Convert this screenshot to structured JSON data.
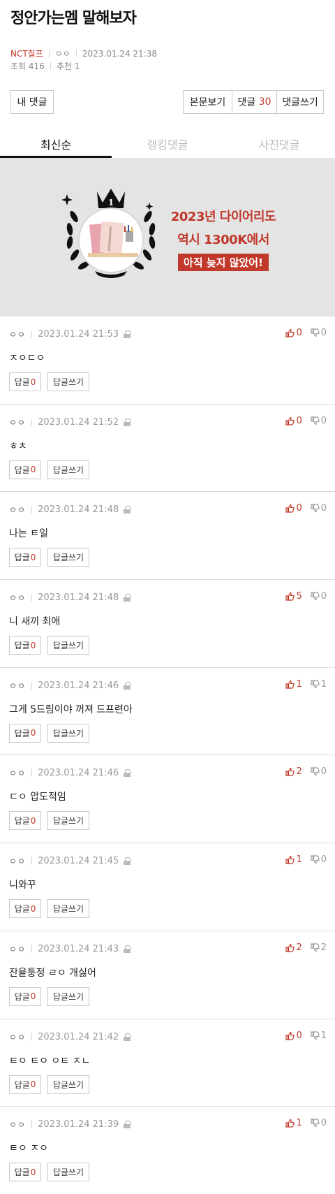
{
  "post": {
    "title": "정안가는멤 말해보자",
    "category": "NCT칠프",
    "author": "ㅇㅇ",
    "date": "2023.01.24 21:38",
    "views_label": "조회 416",
    "recommend_label": "추천 1"
  },
  "toolbar": {
    "my_comments": "내 댓글",
    "view_body": "본문보기",
    "comments_label": "댓글",
    "comments_count": "30",
    "write_comment": "댓글쓰기"
  },
  "tabs": [
    {
      "label": "최신순",
      "active": true
    },
    {
      "label": "랭킹댓글",
      "active": false
    },
    {
      "label": "사진댓글",
      "active": false
    }
  ],
  "banner": {
    "line1": "2023년 다이어리도",
    "line2": "역시 1300K에서",
    "line3": "아직 늦지 않았어!",
    "rank": "1",
    "accent": "#c0392b"
  },
  "reply_label": "답글",
  "reply_write_label": "답글쓰기",
  "comments": [
    {
      "author": "ㅇㅇ",
      "date": "2023.01.24 21:53",
      "text": "ㅈㅇㄷㅇ",
      "up": "0",
      "down": "0",
      "replies": "0"
    },
    {
      "author": "ㅇㅇ",
      "date": "2023.01.24 21:52",
      "text": "ㅎㅊ",
      "up": "0",
      "down": "0",
      "replies": "0"
    },
    {
      "author": "ㅇㅇ",
      "date": "2023.01.24 21:48",
      "text": "나는 ㅌ일",
      "up": "0",
      "down": "0",
      "replies": "0"
    },
    {
      "author": "ㅇㅇ",
      "date": "2023.01.24 21:48",
      "text": "니 새끼 최애",
      "up": "5",
      "down": "0",
      "replies": "0"
    },
    {
      "author": "ㅇㅇ",
      "date": "2023.01.24 21:46",
      "text": "그게 5드림이야 꺼져 드프련아",
      "up": "1",
      "down": "1",
      "replies": "0"
    },
    {
      "author": "ㅇㅇ",
      "date": "2023.01.24 21:46",
      "text": "ㄷㅇ 압도적임",
      "up": "2",
      "down": "0",
      "replies": "0"
    },
    {
      "author": "ㅇㅇ",
      "date": "2023.01.24 21:45",
      "text": "니와꾸",
      "up": "1",
      "down": "0",
      "replies": "0"
    },
    {
      "author": "ㅇㅇ",
      "date": "2023.01.24 21:43",
      "text": "잔윹퉁정 ㄹㅇ 개싫어",
      "up": "2",
      "down": "2",
      "replies": "0"
    },
    {
      "author": "ㅇㅇ",
      "date": "2023.01.24 21:42",
      "text": "ㅌㅇ ㅌㅇ ㅇㅌ ㅈㄴ",
      "up": "0",
      "down": "1",
      "replies": "0"
    },
    {
      "author": "ㅇㅇ",
      "date": "2023.01.24 21:39",
      "text": "ㅌㅇ ㅈㅇ",
      "up": "1",
      "down": "0",
      "replies": "0"
    }
  ]
}
